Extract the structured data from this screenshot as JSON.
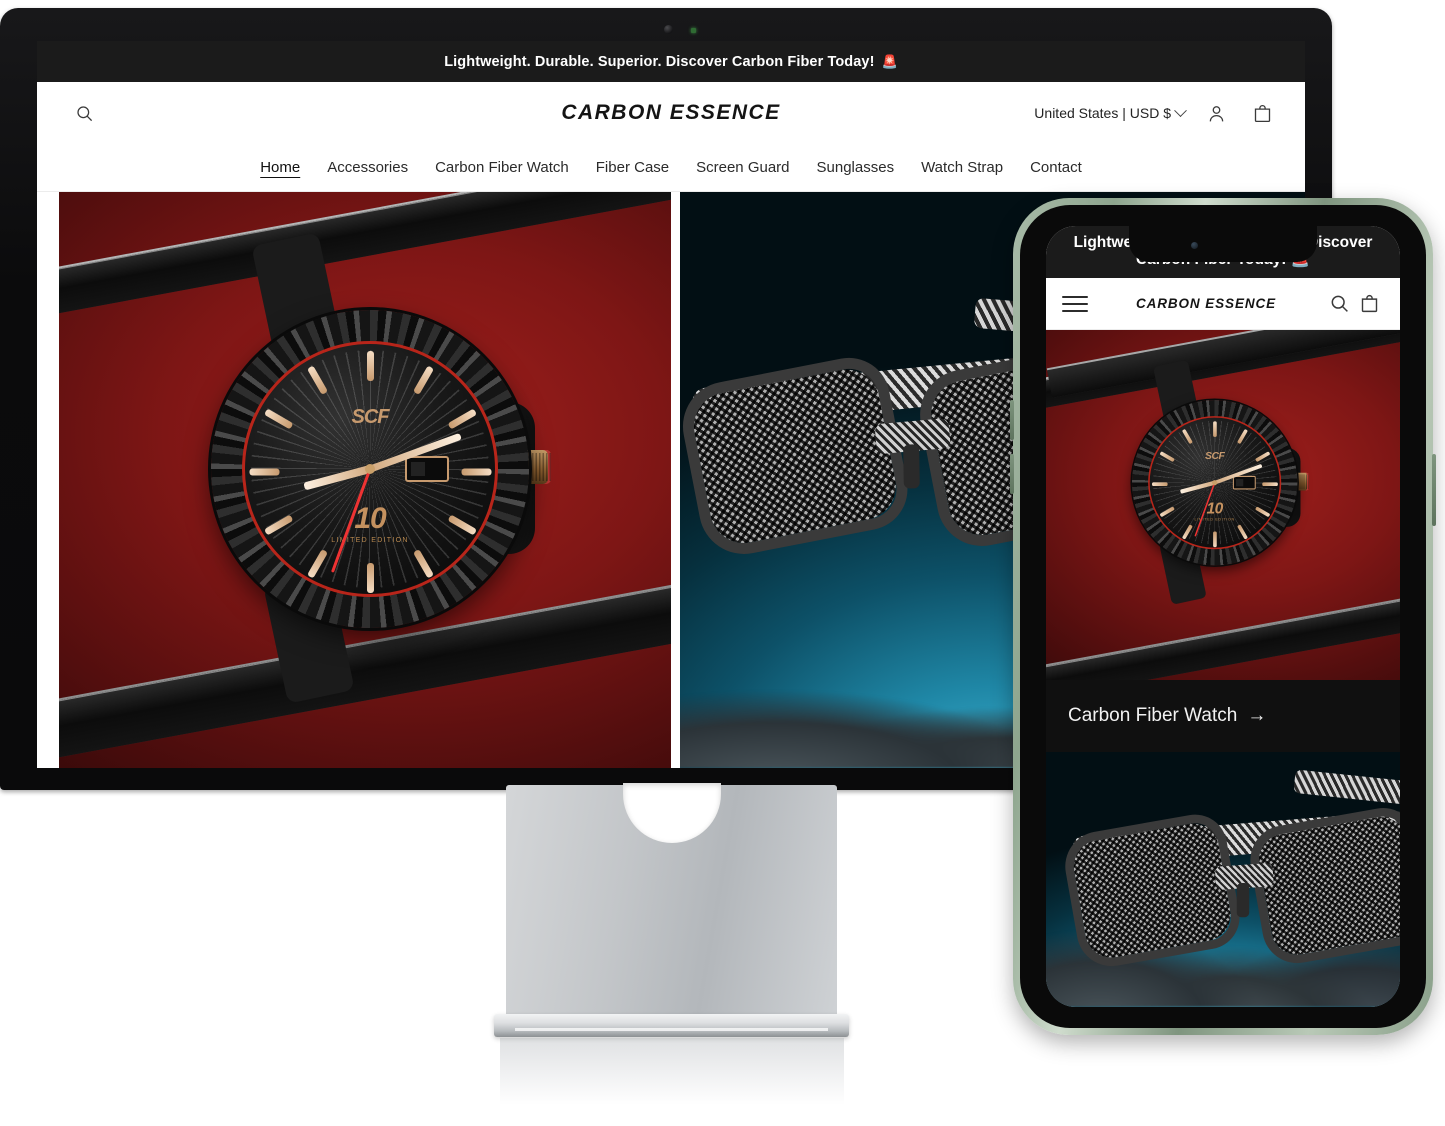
{
  "brand": {
    "name": "CARBON ESSENCE"
  },
  "desktop": {
    "announcement": {
      "text": "Lightweight. Durable. Superior. Discover Carbon Fiber Today!",
      "emoji": "🚨"
    },
    "header": {
      "search_icon": "search-icon",
      "locale_label": "United States | USD $",
      "account_icon": "account-icon",
      "cart_icon": "cart-icon"
    },
    "nav": [
      {
        "label": "Home",
        "active": true
      },
      {
        "label": "Accessories",
        "active": false
      },
      {
        "label": "Carbon Fiber Watch",
        "active": false
      },
      {
        "label": "Fiber Case",
        "active": false
      },
      {
        "label": "Screen Guard",
        "active": false
      },
      {
        "label": "Sunglasses",
        "active": false
      },
      {
        "label": "Watch Strap",
        "active": false
      },
      {
        "label": "Contact",
        "active": false
      }
    ],
    "hero": {
      "watch_card": {
        "alt": "Carbon fiber watch on red background",
        "dial_logo": "SCF",
        "dial_number": "10",
        "dial_subtext": "LIMITED EDITION"
      },
      "glasses_card": {
        "alt": "Carbon fiber sunglasses on teal background"
      }
    }
  },
  "phone": {
    "announcement": {
      "text": "Lightweight. Durable. Superior. Discover Carbon Fiber Today!",
      "emoji": "🚨"
    },
    "header": {
      "menu_icon": "hamburger-menu-icon",
      "search_icon": "search-icon",
      "cart_icon": "cart-icon"
    },
    "cards": [
      {
        "alt": "Carbon fiber watch on red background",
        "caption": "Carbon Fiber Watch",
        "caption_arrow": "→",
        "dial_logo": "SCF",
        "dial_number": "10",
        "dial_subtext": "LIMITED EDITION"
      },
      {
        "alt": "Carbon fiber sunglasses on teal background",
        "caption": ""
      }
    ]
  },
  "colors": {
    "announcement_bg": "#1b1b1b",
    "page_bg": "#ffffff",
    "watch_bg_red": "#7e1615",
    "glasses_bg_teal": "#1f87a6",
    "accent_rose_gold": "#c79a6e",
    "accent_red": "#b8251a",
    "phone_frame": "#8ea58e"
  }
}
